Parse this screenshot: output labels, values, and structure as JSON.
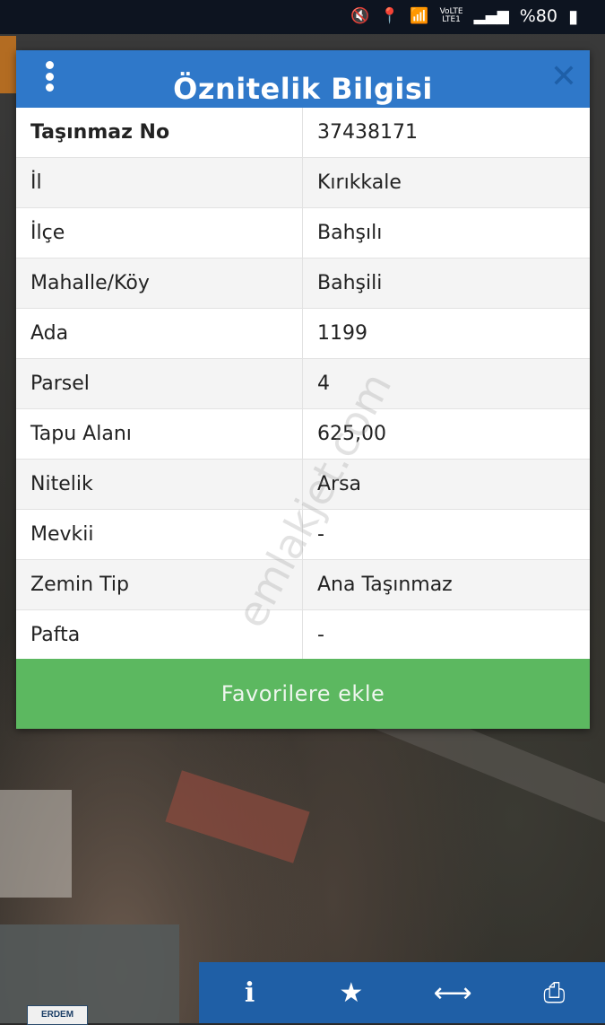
{
  "status_bar": {
    "lte_top": "VoLTE",
    "lte_bottom": "LTE1",
    "battery": "%80"
  },
  "dialog": {
    "title": "Öznitelik Bilgisi",
    "rows": [
      {
        "key": "Taşınmaz No",
        "value": "37438171"
      },
      {
        "key": "İl",
        "value": "Kırıkkale"
      },
      {
        "key": "İlçe",
        "value": "Bahşılı"
      },
      {
        "key": "Mahalle/Köy",
        "value": "Bahşili"
      },
      {
        "key": "Ada",
        "value": "1199"
      },
      {
        "key": "Parsel",
        "value": "4"
      },
      {
        "key": "Tapu Alanı",
        "value": "625,00"
      },
      {
        "key": "Nitelik",
        "value": "Arsa"
      },
      {
        "key": "Mevkii",
        "value": "-"
      },
      {
        "key": "Zemin Tip",
        "value": "Ana Taşınmaz"
      },
      {
        "key": "Pafta",
        "value": "-"
      }
    ],
    "favorite_button": "Favorilere ekle"
  },
  "watermark": "emlakjet.com",
  "logo_text": "ERDEM",
  "bottom_bar": {
    "icons": [
      "info-icon",
      "star-icon",
      "measure-arrows-icon",
      "printer-icon"
    ]
  }
}
